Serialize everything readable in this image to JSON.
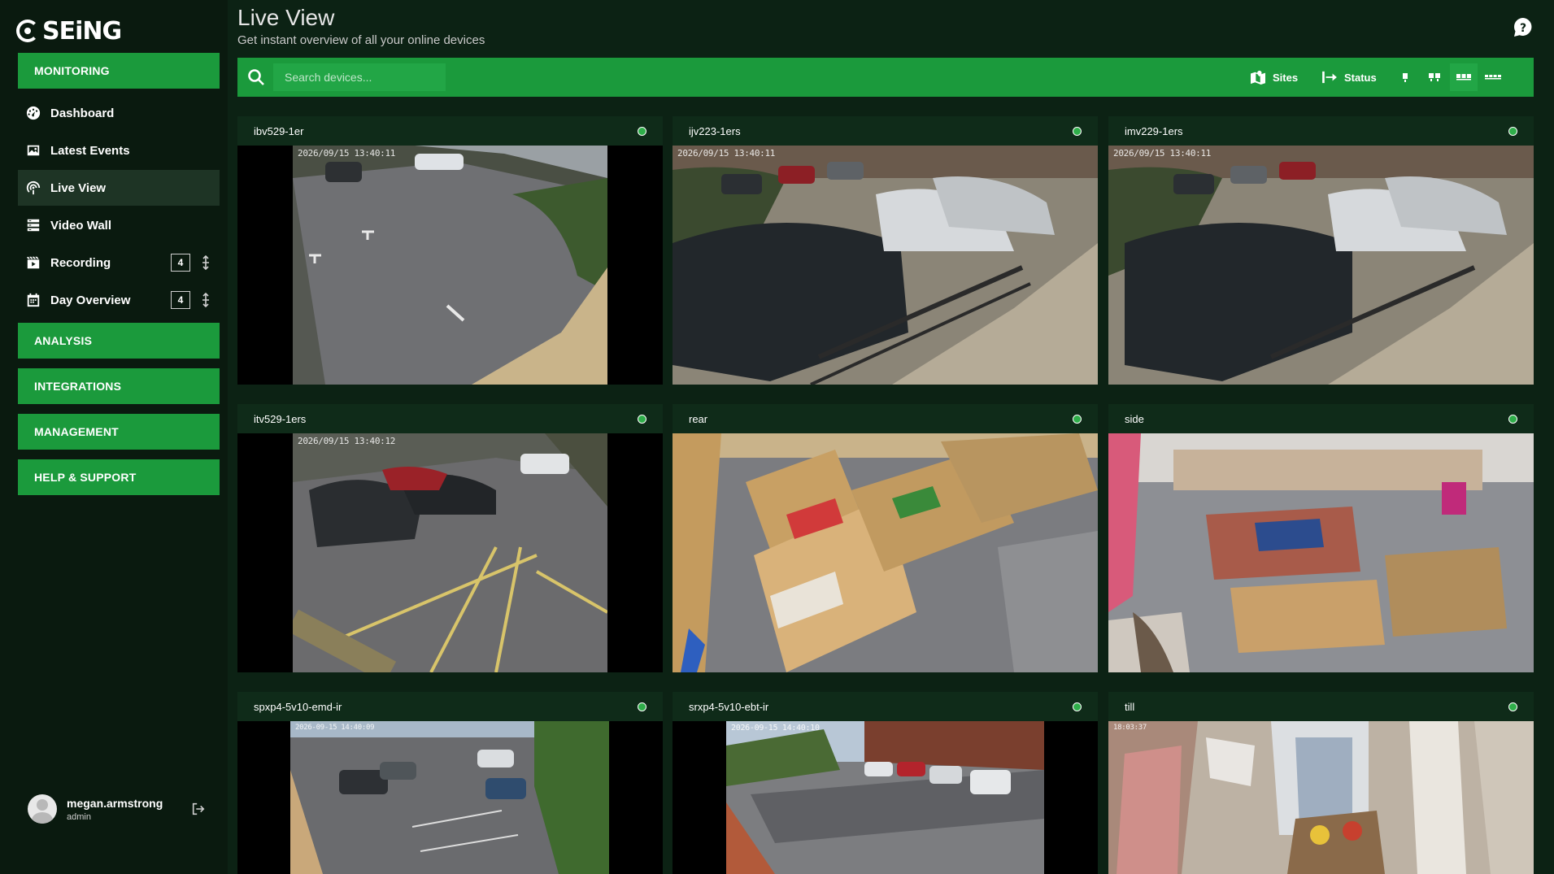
{
  "app": {
    "logo_text": "SEiNG"
  },
  "sidebar": {
    "sections": [
      {
        "label": "MONITORING"
      },
      {
        "label": "ANALYSIS"
      },
      {
        "label": "INTEGRATIONS"
      },
      {
        "label": "MANAGEMENT"
      },
      {
        "label": "HELP & SUPPORT"
      }
    ],
    "items": [
      {
        "label": "Dashboard",
        "icon": "dashboard-icon"
      },
      {
        "label": "Latest Events",
        "icon": "image-icon"
      },
      {
        "label": "Live View",
        "icon": "live-view-icon",
        "active": true
      },
      {
        "label": "Video Wall",
        "icon": "video-wall-icon"
      },
      {
        "label": "Recording",
        "icon": "recording-icon",
        "count": "4"
      },
      {
        "label": "Day Overview",
        "icon": "calendar-icon",
        "count": "4"
      }
    ],
    "user": {
      "name": "megan.armstrong",
      "role": "admin"
    }
  },
  "header": {
    "title": "Live View",
    "subtitle": "Get instant overview of all your online devices"
  },
  "toolbar": {
    "search_placeholder": "Search devices...",
    "sites_label": "Sites",
    "status_label": "Status",
    "layouts": [
      "1-column",
      "2-column",
      "3-column",
      "4-column"
    ],
    "active_layout": "3-column"
  },
  "cameras": [
    {
      "name": "ibv529-1er",
      "status": "online",
      "timestamp": "2026/09/15 13:40:11",
      "status_color": "#2fae4a"
    },
    {
      "name": "ijv223-1ers",
      "status": "online",
      "timestamp": "2026/09/15 13:40:11",
      "status_color": "#2fae4a"
    },
    {
      "name": "imv229-1ers",
      "status": "online",
      "timestamp": "2026/09/15 13:40:11",
      "status_color": "#2fae4a"
    },
    {
      "name": "itv529-1ers",
      "status": "online",
      "timestamp": "2026/09/15 13:40:12",
      "status_color": "#2fae4a"
    },
    {
      "name": "rear",
      "status": "online",
      "timestamp": "",
      "status_color": "#2fae4a"
    },
    {
      "name": "side",
      "status": "online",
      "timestamp": "",
      "status_color": "#2fae4a"
    },
    {
      "name": "spxp4-5v10-emd-ir",
      "status": "online",
      "timestamp": "2026-09-15 14:40:09",
      "status_color": "#2fae4a"
    },
    {
      "name": "srxp4-5v10-ebt-ir",
      "status": "online",
      "timestamp": "2026-09-15 14:40:10",
      "status_color": "#2fae4a"
    },
    {
      "name": "till",
      "status": "online",
      "timestamp": "18:03:37",
      "status_color": "#2fae4a"
    }
  ],
  "colors": {
    "accent": "#1b9a3c",
    "background": "#0c2214",
    "sidebar": "#0a1a0f",
    "online": "#2fae4a"
  }
}
